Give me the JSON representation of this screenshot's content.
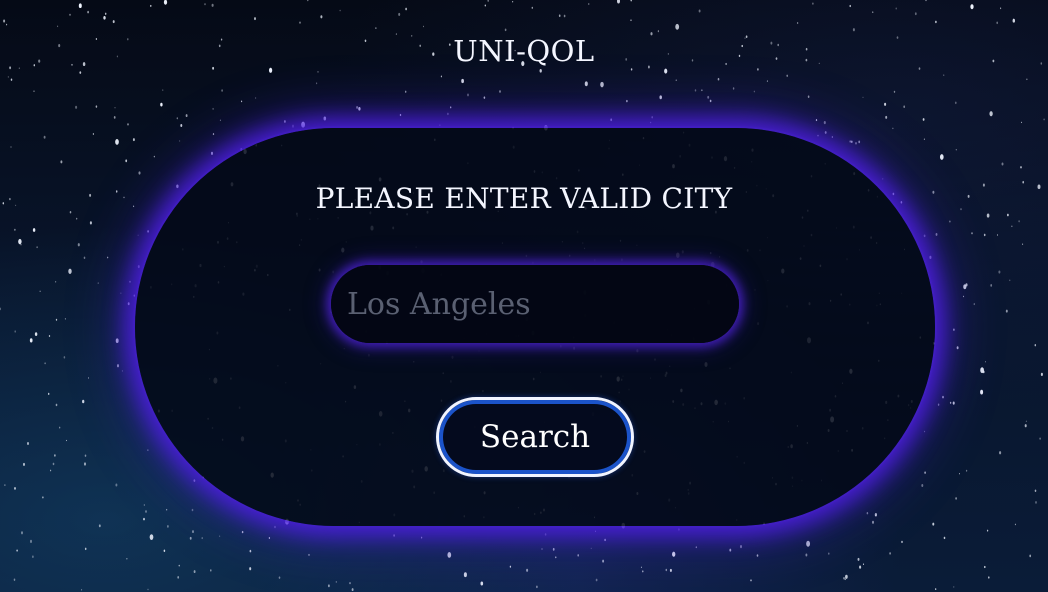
{
  "header": {
    "app_title": "UNI-QOL"
  },
  "form": {
    "heading": "PLEASE ENTER VALID CITY",
    "city_input_value": "",
    "city_input_placeholder": "Los Angeles",
    "search_label": "Search"
  },
  "theme": {
    "background": "#060c1c",
    "card_fill": "#040918",
    "glow": "#5a1ee6",
    "button_ring": "#1b53c9",
    "text": "#f4f6ff",
    "placeholder": "#5a6072"
  }
}
